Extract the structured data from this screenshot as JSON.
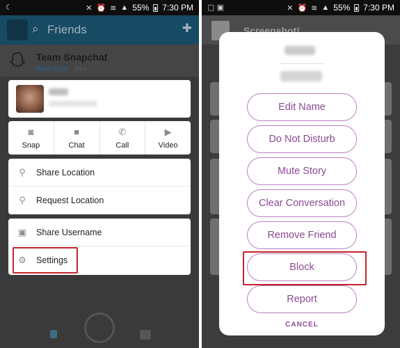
{
  "status_bar": {
    "battery": "55%",
    "time": "7:30 PM"
  },
  "left": {
    "header_title": "Friends",
    "team": {
      "name": "Team Snapchat",
      "status": "New Chat",
      "age": "14w"
    },
    "actions": [
      {
        "label": "Snap",
        "icon": "camera-icon"
      },
      {
        "label": "Chat",
        "icon": "chat-bubble-icon"
      },
      {
        "label": "Call",
        "icon": "phone-icon"
      },
      {
        "label": "Video",
        "icon": "video-camera-icon"
      }
    ],
    "location_items": [
      {
        "label": "Share Location",
        "icon": "location-pin-icon"
      },
      {
        "label": "Request Location",
        "icon": "location-request-icon"
      }
    ],
    "user_items": [
      {
        "label": "Share Username",
        "icon": "share-username-icon"
      },
      {
        "label": "Settings",
        "icon": "gear-icon"
      }
    ]
  },
  "right": {
    "background_title": "Screenshot!",
    "options": [
      "Edit Name",
      "Do Not Disturb",
      "Mute Story",
      "Clear Conversation",
      "Remove Friend",
      "Block",
      "Report"
    ],
    "cancel_label": "CANCEL"
  },
  "colors": {
    "highlight": "#c0242b",
    "accent_purple": "#8b4a94",
    "header_blue": "#174a63"
  }
}
